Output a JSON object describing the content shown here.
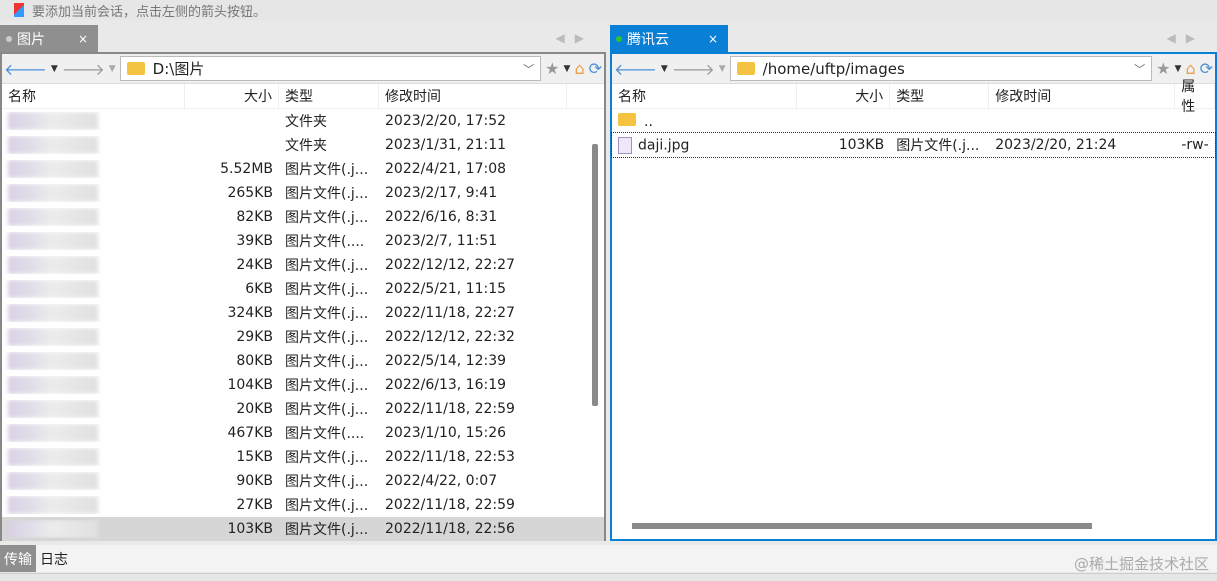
{
  "info_text": "要添加当前会话，点击左侧的箭头按钮。",
  "left": {
    "tab": "图片",
    "tab_close": "×",
    "path": "D:\\图片",
    "columns": [
      "名称",
      "大小",
      "类型",
      "修改时间"
    ],
    "rows": [
      {
        "size": "",
        "type": "文件夹",
        "modified": "2023/2/20, 17:52"
      },
      {
        "size": "",
        "type": "文件夹",
        "modified": "2023/1/31, 21:11"
      },
      {
        "size": "5.52MB",
        "type": "图片文件(.j...",
        "modified": "2022/4/21, 17:08"
      },
      {
        "size": "265KB",
        "type": "图片文件(.j...",
        "modified": "2023/2/17, 9:41"
      },
      {
        "size": "82KB",
        "type": "图片文件(.j...",
        "modified": "2022/6/16, 8:31"
      },
      {
        "size": "39KB",
        "type": "图片文件(....",
        "modified": "2023/2/7, 11:51"
      },
      {
        "size": "24KB",
        "type": "图片文件(.j...",
        "modified": "2022/12/12, 22:27"
      },
      {
        "size": "6KB",
        "type": "图片文件(.j...",
        "modified": "2022/5/21, 11:15"
      },
      {
        "size": "324KB",
        "type": "图片文件(.j...",
        "modified": "2022/11/18, 22:27"
      },
      {
        "size": "29KB",
        "type": "图片文件(.j...",
        "modified": "2022/12/12, 22:32"
      },
      {
        "size": "80KB",
        "type": "图片文件(.j...",
        "modified": "2022/5/14, 12:39"
      },
      {
        "size": "104KB",
        "type": "图片文件(.j...",
        "modified": "2022/6/13, 16:19"
      },
      {
        "size": "20KB",
        "type": "图片文件(.j...",
        "modified": "2022/11/18, 22:59"
      },
      {
        "size": "467KB",
        "type": "图片文件(....",
        "modified": "2023/1/10, 15:26"
      },
      {
        "size": "15KB",
        "type": "图片文件(.j...",
        "modified": "2022/11/18, 22:53"
      },
      {
        "size": "90KB",
        "type": "图片文件(.j...",
        "modified": "2022/4/22, 0:07"
      },
      {
        "size": "27KB",
        "type": "图片文件(.j...",
        "modified": "2022/11/18, 22:59"
      },
      {
        "size": "103KB",
        "type": "图片文件(.j...",
        "modified": "2022/11/18, 22:56"
      }
    ]
  },
  "right": {
    "tab": "腾讯云",
    "tab_close": "×",
    "path": "/home/uftp/images",
    "columns": [
      "名称",
      "大小",
      "类型",
      "修改时间",
      "属性"
    ],
    "rows": [
      {
        "name": "..",
        "size": "",
        "type": "",
        "modified": "",
        "attr": ""
      },
      {
        "name": "daji.jpg",
        "size": "103KB",
        "type": "图片文件(.j...",
        "modified": "2023/2/20, 21:24",
        "attr": "-rw-"
      }
    ]
  },
  "bottom_tabs": [
    "传输",
    "日志"
  ],
  "watermark": "@稀土掘金技术社区",
  "colors": {
    "accent": "#0a7fd6",
    "connected": "#2ec22e"
  }
}
